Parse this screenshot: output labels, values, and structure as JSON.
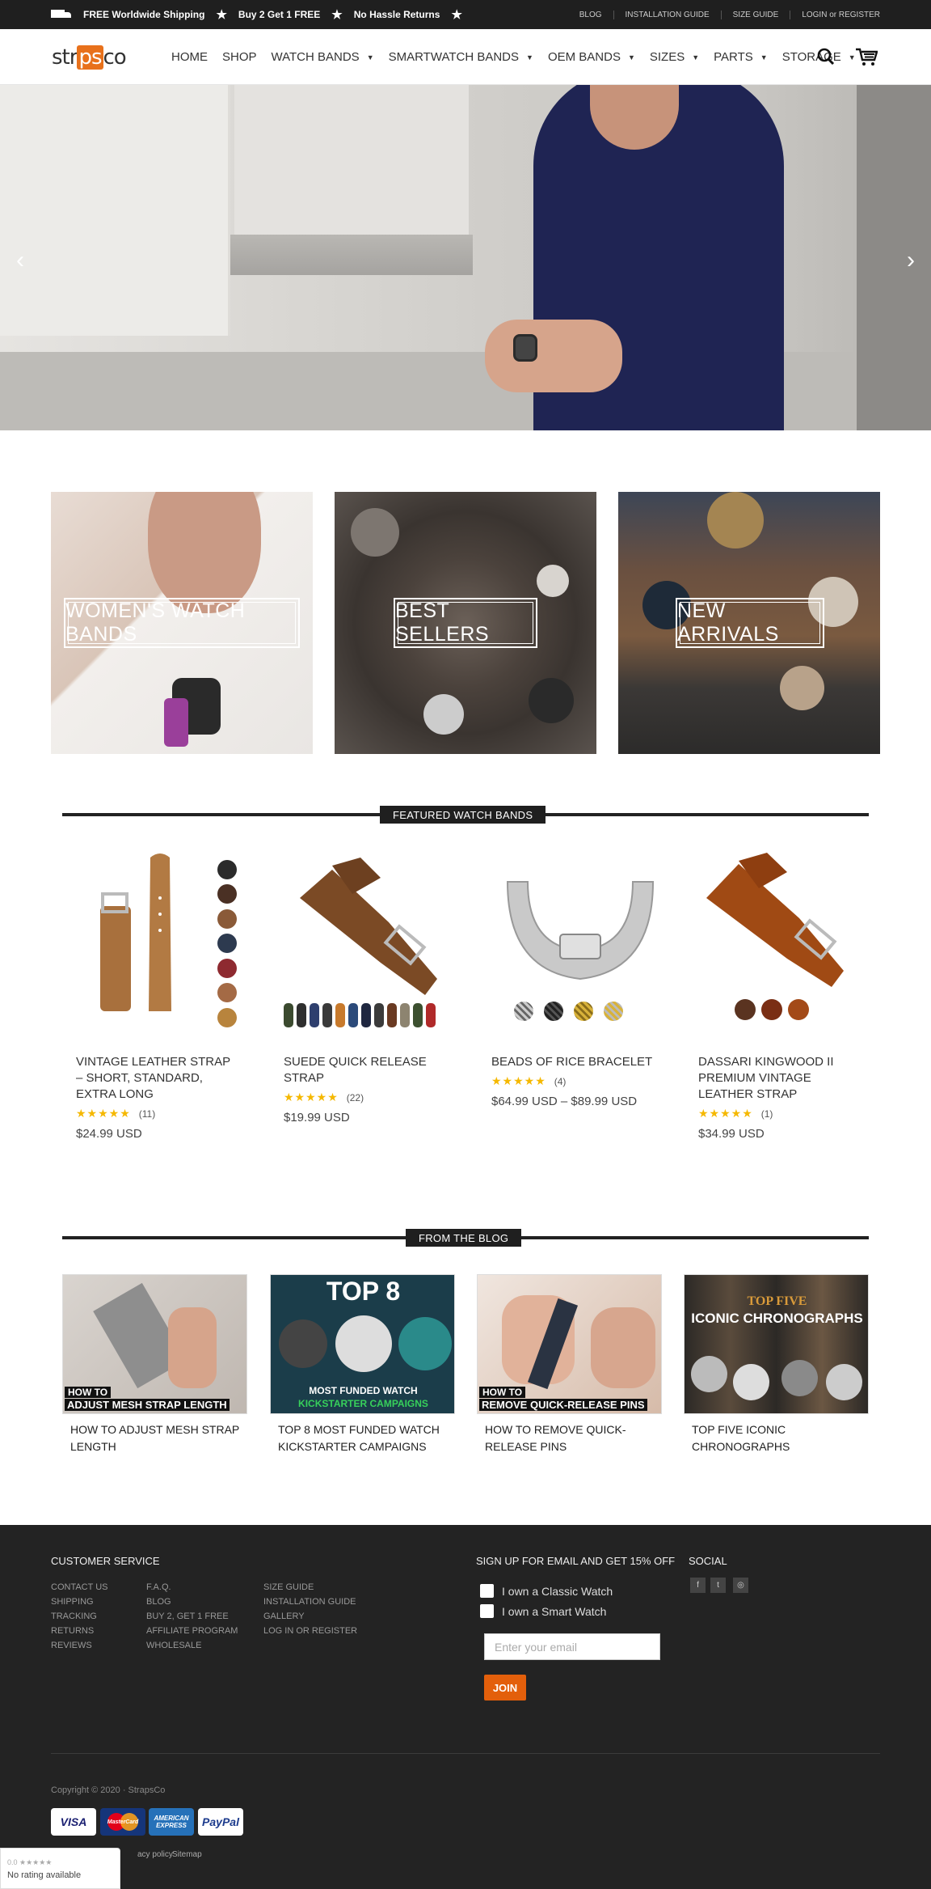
{
  "topbar": {
    "promos": [
      "FREE Worldwide Shipping",
      "Buy 2 Get 1 FREE",
      "No Hassle Returns"
    ],
    "links": [
      "BLOG",
      "INSTALLATION GUIDE",
      "SIZE GUIDE",
      "LOGIN or REGISTER"
    ]
  },
  "header": {
    "logo": {
      "pre": "str",
      "mid": "ps",
      "post": "co"
    },
    "nav": [
      "HOME",
      "SHOP",
      "WATCH BANDS",
      "SMARTWATCH BANDS",
      "OEM BANDS",
      "SIZES",
      "PARTS",
      "STORAGE"
    ]
  },
  "categories": [
    "WOMEN'S WATCH BANDS",
    "BEST SELLERS",
    "NEW ARRIVALS"
  ],
  "featured": {
    "heading": "FEATURED WATCH BANDS",
    "products": [
      {
        "name": "VINTAGE LEATHER STRAP – SHORT, STANDARD, EXTRA LONG",
        "stars": "★★★★★",
        "count": "(11)",
        "price": "$24.99 USD",
        "rating": 5
      },
      {
        "name": "SUEDE QUICK RELEASE STRAP",
        "stars": "★★★★★",
        "count": "(22)",
        "price": "$19.99 USD",
        "rating": 5
      },
      {
        "name": "BEADS OF RICE BRACELET",
        "stars": "★★★★★",
        "count": "(4)",
        "price": "$64.99 USD – $89.99 USD",
        "rating": 5
      },
      {
        "name": "DASSARI KINGWOOD II PREMIUM VINTAGE LEATHER STRAP",
        "stars": "★★★★★",
        "count": "(1)",
        "price": "$34.99 USD",
        "rating": 5
      }
    ]
  },
  "blog": {
    "heading": "FROM THE BLOG",
    "posts": [
      {
        "title": "HOW TO ADJUST MESH STRAP LENGTH",
        "cap1": "HOW TO",
        "cap2": "ADJUST MESH STRAP LENGTH"
      },
      {
        "title": "TOP 8 MOST FUNDED WATCH KICKSTARTER CAMPAIGNS",
        "cap1": "TOP 8",
        "cap2": "MOST FUNDED WATCH",
        "cap3": "KICKSTARTER CAMPAIGNS"
      },
      {
        "title": "HOW TO REMOVE QUICK-RELEASE PINS",
        "cap1": "HOW TO",
        "cap2": "REMOVE QUICK-RELEASE PINS"
      },
      {
        "title": "TOP FIVE ICONIC CHRONOGRAPHS",
        "cap1": "TOP FIVE",
        "cap2": "ICONIC CHRONOGRAPHS"
      }
    ]
  },
  "footer": {
    "service_heading": "CUSTOMER SERVICE",
    "col1": [
      "CONTACT US",
      "SHIPPING",
      "TRACKING",
      "RETURNS",
      "REVIEWS"
    ],
    "col2": [
      "F.A.Q.",
      "BLOG",
      "BUY 2, GET 1 FREE",
      "AFFILIATE PROGRAM",
      "WHOLESALE"
    ],
    "col3": [
      "SIZE GUIDE",
      "INSTALLATION GUIDE",
      "GALLERY",
      "LOG IN OR REGISTER"
    ],
    "signup_heading": "SIGN UP FOR EMAIL AND GET 15% OFF",
    "check_classic": "I own a Classic Watch",
    "check_smart": "I own a Smart Watch",
    "email_placeholder": "Enter your email",
    "join": "JOIN",
    "social_heading": "SOCIAL",
    "social": [
      "f",
      "t",
      "◎"
    ],
    "copyright": "Copyright © 2020 · StrapsCo",
    "payments": [
      "VISA",
      "MasterCard",
      "AMERICAN EXPRESS",
      "PayPal"
    ],
    "legal": [
      "acy policy",
      "Sitemap"
    ]
  },
  "google_badge": {
    "stars": "0.0 ★★★★★",
    "text": "No rating available"
  },
  "colors": {
    "accent": "#e35f0b",
    "star": "#f5b800",
    "dark": "#1f1f1f"
  }
}
